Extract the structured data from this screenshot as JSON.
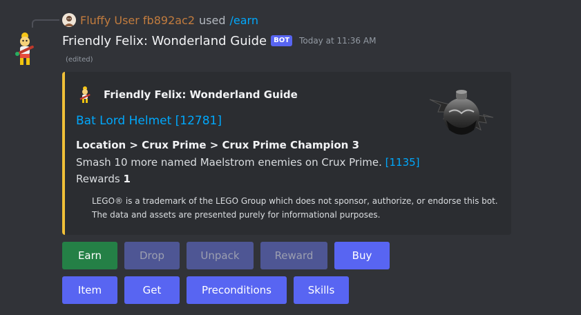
{
  "reply": {
    "user": "Fluffy User fb892ac2",
    "used": "used",
    "command": "/earn"
  },
  "message": {
    "author": "Friendly Felix: Wonderland Guide",
    "bot_tag": "BOT",
    "timestamp": "Today at 11:36 AM",
    "edited": "(edited)"
  },
  "embed": {
    "accent_color": "#f0c038",
    "author_name": "Friendly Felix: Wonderland Guide",
    "title": "Bat Lord Helmet [12781]",
    "field_name": "Location > Crux Prime > Crux Prime Champion 3",
    "description": "Smash 10 more named Maelstrom enemies on Crux Prime.",
    "description_link": "[1135]",
    "rewards_label": "Rewards",
    "rewards_value": "1",
    "footer": "LEGO® is a trademark of the LEGO Group which does not sponsor, authorize, or endorse this bot. The data and assets are presented purely for informational purposes.",
    "thumbnail_icon": "bat-lord-helmet-image"
  },
  "buttons_row1": [
    {
      "label": "Earn",
      "style": "green",
      "enabled": true
    },
    {
      "label": "Drop",
      "style": "blurple",
      "enabled": false
    },
    {
      "label": "Unpack",
      "style": "blurple",
      "enabled": false
    },
    {
      "label": "Reward",
      "style": "blurple",
      "enabled": false
    },
    {
      "label": "Buy",
      "style": "blurple",
      "enabled": true
    }
  ],
  "buttons_row2": [
    {
      "label": "Item",
      "style": "blurple",
      "enabled": true
    },
    {
      "label": "Get",
      "style": "blurple",
      "enabled": true
    },
    {
      "label": "Preconditions",
      "style": "blurple",
      "enabled": true
    },
    {
      "label": "Skills",
      "style": "blurple",
      "enabled": true
    }
  ],
  "colors": {
    "background": "#313338",
    "embed_background": "#2b2d31",
    "link": "#00a8fc",
    "button_blurple": "#5865f2",
    "button_green": "#248046",
    "reply_user": "#c27c3e"
  }
}
